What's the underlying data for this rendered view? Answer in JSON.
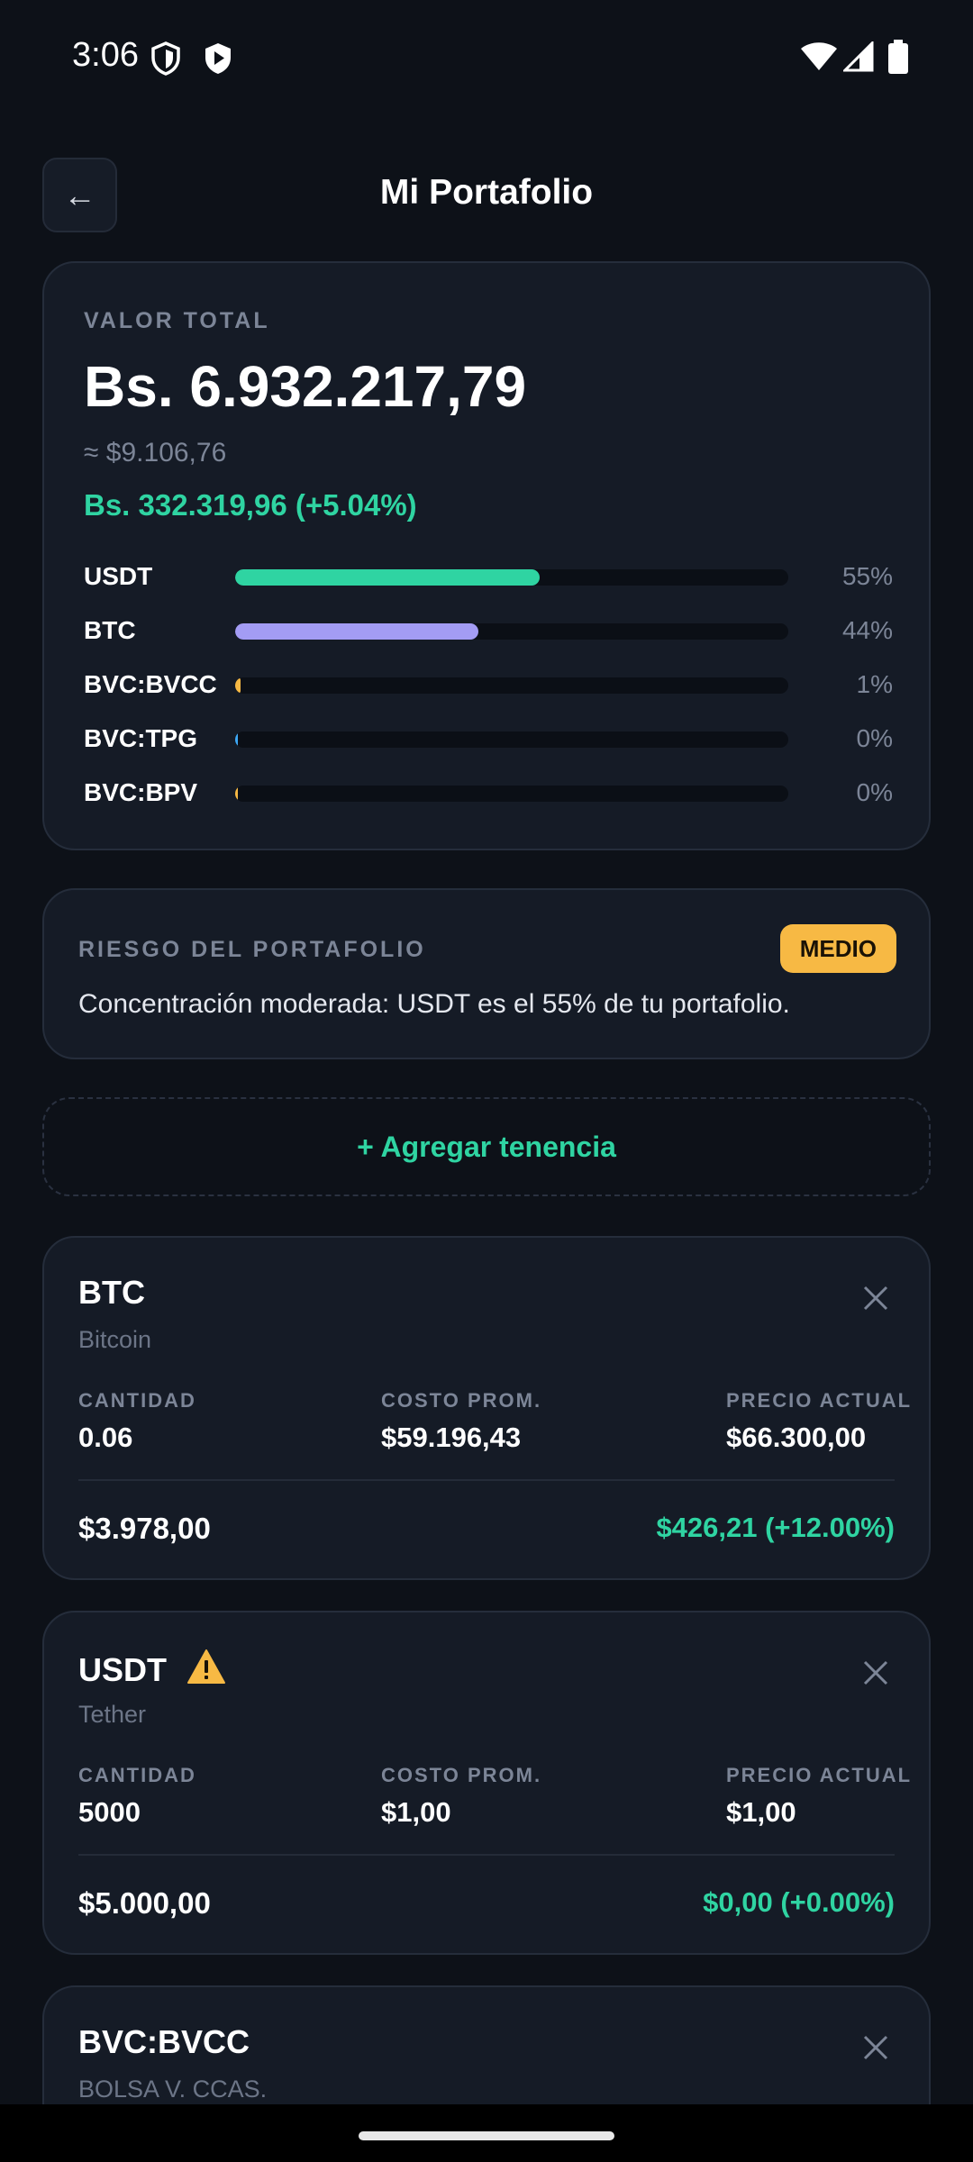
{
  "status_bar": {
    "time": "3:06",
    "icons": [
      "shield-outline-icon",
      "shield-play-icon",
      "wifi-icon",
      "signal-icon",
      "battery-icon"
    ]
  },
  "header": {
    "back_label": "←",
    "title": "Mi Portafolio"
  },
  "total": {
    "label": "VALOR TOTAL",
    "value": "Bs. 6.932.217,79",
    "usd": "≈ $9.106,76",
    "change": "Bs. 332.319,96 (+5.04%)"
  },
  "allocation": [
    {
      "name": "USDT",
      "pct_label": "55%",
      "fill_pct": 55,
      "color": "#2fd4a2"
    },
    {
      "name": "BTC",
      "pct_label": "44%",
      "fill_pct": 44,
      "color": "#a39cf4"
    },
    {
      "name": "BVC:BVCC",
      "pct_label": "1%",
      "fill_pct": 1,
      "color": "#f7b944"
    },
    {
      "name": "BVC:TPG",
      "pct_label": "0%",
      "fill_pct": 0.5,
      "color": "#3da8f5"
    },
    {
      "name": "BVC:BPV",
      "pct_label": "0%",
      "fill_pct": 0.5,
      "color": "#f7b944"
    }
  ],
  "risk": {
    "label": "RIESGO DEL PORTAFOLIO",
    "badge": "MEDIO",
    "text": "Concentración moderada: USDT es el 55% de tu portafolio."
  },
  "add_button": "+ Agregar tenencia",
  "col_labels": {
    "quantity": "CANTIDAD",
    "avg_cost": "COSTO PROM.",
    "current_price": "PRECIO ACTUAL"
  },
  "holdings": [
    {
      "symbol": "BTC",
      "name": "Bitcoin",
      "warning": false,
      "quantity": "0.06",
      "avg_cost": "$59.196,43",
      "current_price": "$66.300,00",
      "total": "$3.978,00",
      "pl": "$426,21 (+12.00%)"
    },
    {
      "symbol": "USDT",
      "name": "Tether",
      "warning": true,
      "quantity": "5000",
      "avg_cost": "$1,00",
      "current_price": "$1,00",
      "total": "$5.000,00",
      "pl": "$0,00 (+0.00%)"
    },
    {
      "symbol": "BVC:BVCC",
      "name": "BOLSA V. CCAS."
    }
  ]
}
